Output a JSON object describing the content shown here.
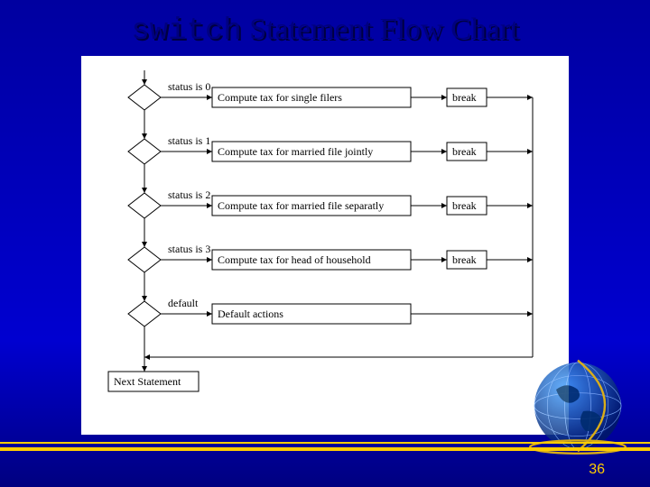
{
  "title": {
    "code": "switch",
    "rest": " Statement Flow Chart"
  },
  "flow": {
    "cases": [
      {
        "cond": "status is 0",
        "action": "Compute tax for single filers",
        "has_break": true
      },
      {
        "cond": "status is 1",
        "action": "Compute tax for married file jointly",
        "has_break": true
      },
      {
        "cond": "status is 2",
        "action": "Compute tax for married file separatly",
        "has_break": true
      },
      {
        "cond": "status is 3",
        "action": "Compute tax for head of household",
        "has_break": true
      },
      {
        "cond": "default",
        "action": "Default actions",
        "has_break": false
      }
    ],
    "exit_label": "Next Statement",
    "break_label": "break"
  },
  "page_number": "36"
}
